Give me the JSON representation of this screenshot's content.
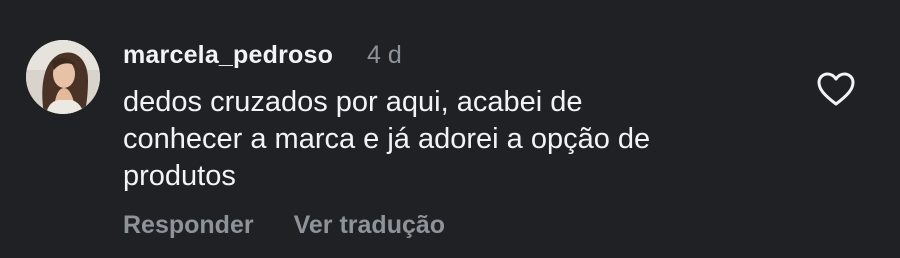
{
  "comment": {
    "username": "marcela_pedroso",
    "timestamp": "4 d",
    "text_lines": [
      "dedos cruzados por aqui, acabei de",
      "conhecer a marca e já adorei a opção de",
      "produtos"
    ],
    "actions": {
      "reply": "Responder",
      "translate": "Ver tradução"
    },
    "like_icon": "heart-outline-icon"
  },
  "colors": {
    "background": "#1f2125",
    "primary_text": "#f2f3f5",
    "secondary_text": "#8e9299"
  }
}
